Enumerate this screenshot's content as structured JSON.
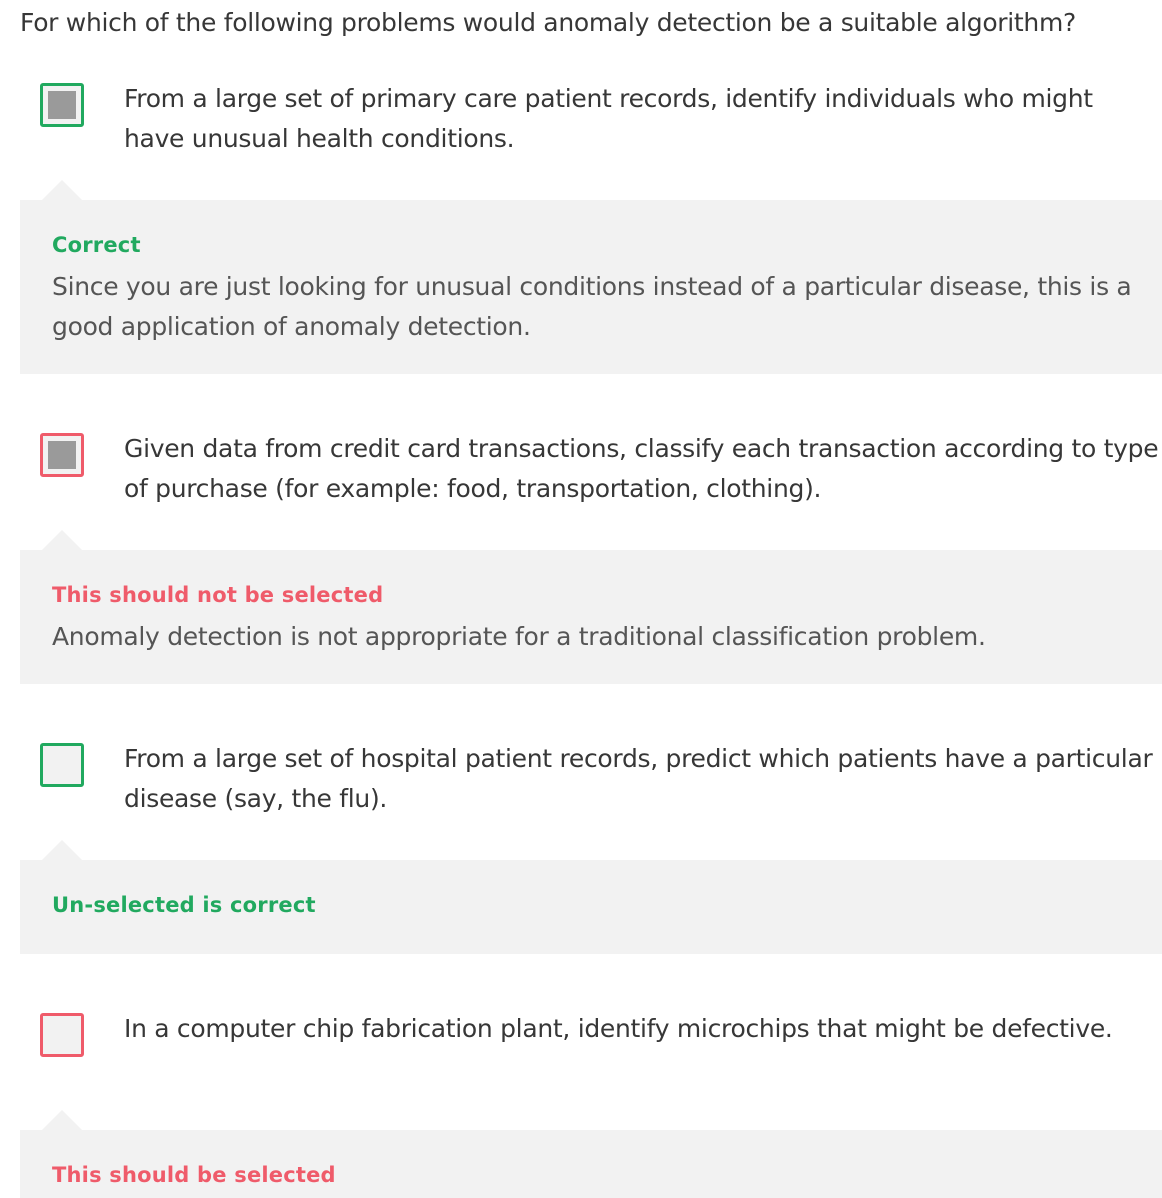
{
  "question": "For which of the following problems would anomaly detection be a suitable algorithm?",
  "options": [
    {
      "text": "From a large set of primary care patient records, identify individuals who might have unusual health conditions.",
      "checked": true,
      "result_color": "#21a95f",
      "feedback_status": "Correct",
      "feedback_explanation": "Since you are just looking for unusual conditions instead of a particular disease, this is a good application of anomaly detection."
    },
    {
      "text": "Given data from credit card transactions, classify each transaction according to type of purchase (for example: food, transportation, clothing).",
      "checked": true,
      "result_color": "#ef5b6a",
      "feedback_status": "This should not be selected",
      "feedback_explanation": "Anomaly detection is not appropriate for a traditional classification problem."
    },
    {
      "text": "From a large set of hospital patient records, predict which patients have a particular disease (say, the flu).",
      "checked": false,
      "result_color": "#21a95f",
      "feedback_status": "Un-selected is correct",
      "feedback_explanation": ""
    },
    {
      "text": "In a computer chip fabrication plant, identify microchips that might be defective.",
      "checked": false,
      "result_color": "#ef5b6a",
      "feedback_status": "This should be selected",
      "feedback_explanation": ""
    }
  ],
  "colors": {
    "correct": "#21a95f",
    "incorrect": "#ef5b6a",
    "feedback_bg": "#f2f2f2",
    "checked_fill": "#9a9a9a"
  }
}
